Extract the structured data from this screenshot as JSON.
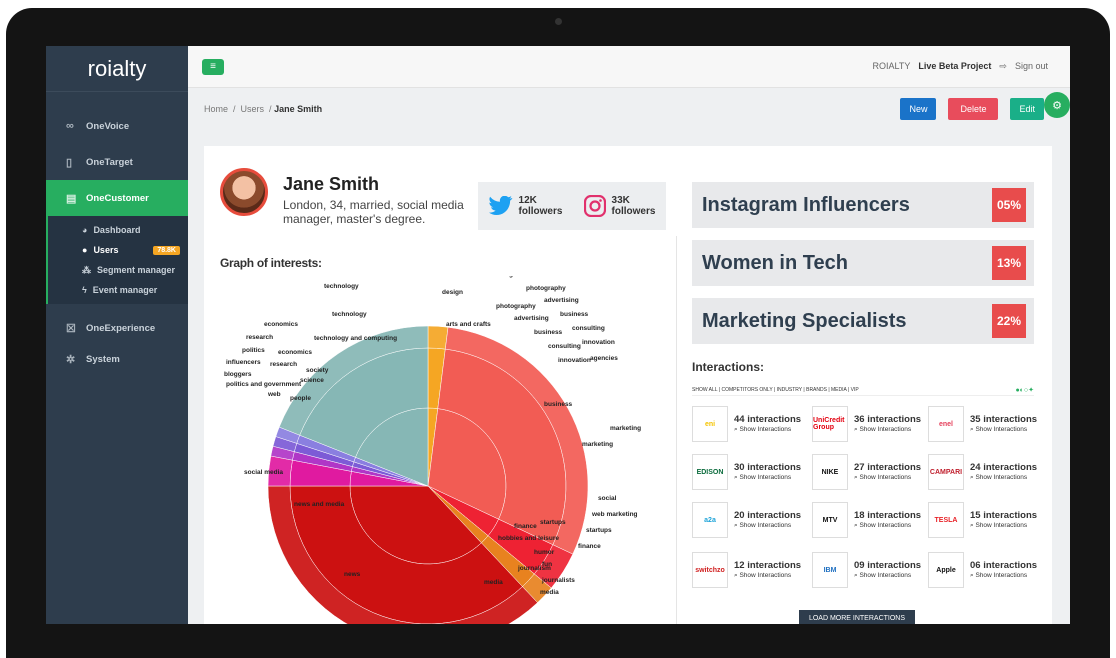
{
  "app": {
    "logo": "roialty"
  },
  "sidebar": {
    "items": [
      {
        "label": "OneVoice",
        "icon": "binoculars-icon"
      },
      {
        "label": "OneTarget",
        "icon": "phone-icon"
      },
      {
        "label": "OneCustomer",
        "icon": "card-icon"
      },
      {
        "label": "OneExperience",
        "icon": "experience-icon"
      },
      {
        "label": "System",
        "icon": "gear-icon"
      }
    ],
    "sub": [
      {
        "label": "Dashboard",
        "icon": "dashboard-icon"
      },
      {
        "label": "Users",
        "icon": "user-icon",
        "badge": "78.8K"
      },
      {
        "label": "Segment manager",
        "icon": "users-icon"
      },
      {
        "label": "Event manager",
        "icon": "bolt-icon"
      }
    ]
  },
  "topbar": {
    "brand": "ROIALTY",
    "project": "Live Beta Project",
    "signout": "Sign out"
  },
  "breadcrumb": {
    "home": "Home",
    "users": "Users",
    "current": "Jane Smith"
  },
  "actions": {
    "new": "New",
    "delete": "Delete",
    "edit": "Edit"
  },
  "profile": {
    "name": "Jane Smith",
    "description": "London, 34, married, social media manager, master's degree.",
    "twitter": {
      "count": "12K",
      "label": "followers"
    },
    "instagram": {
      "count": "33K",
      "label": "followers"
    }
  },
  "graph_title": "Graph of interests:",
  "segments": [
    {
      "name": "Instagram Influencers",
      "pct": "05%"
    },
    {
      "name": "Women in Tech",
      "pct": "13%"
    },
    {
      "name": "Marketing Specialists",
      "pct": "22%"
    }
  ],
  "interactions": {
    "title": "Interactions:",
    "filter": "SHOW ALL | COMPETITORS ONLY | INDUSTRY | BRANDS | MEDIA | VIP",
    "show_label": "Show Interactions",
    "load_more": "LOAD MORE INTERACTIONS",
    "brands": [
      {
        "logo": "eni",
        "count": "44 interactions",
        "color": "#f5c400"
      },
      {
        "logo": "UniCredit Group",
        "count": "36 interactions",
        "color": "#e3000f"
      },
      {
        "logo": "enel",
        "count": "35 interactions",
        "color": "#e53f5a"
      },
      {
        "logo": "EDISON",
        "count": "30 interactions",
        "color": "#0a6b3c"
      },
      {
        "logo": "NIKE",
        "count": "27 interactions",
        "color": "#111111"
      },
      {
        "logo": "CAMPARI",
        "count": "24 interactions",
        "color": "#c0202e"
      },
      {
        "logo": "a2a",
        "count": "20 interactions",
        "color": "#1da3d8"
      },
      {
        "logo": "MTV",
        "count": "18 interactions",
        "color": "#111111"
      },
      {
        "logo": "TESLA",
        "count": "15 interactions",
        "color": "#e82127"
      },
      {
        "logo": "switchzo",
        "count": "12 interactions",
        "color": "#d02020"
      },
      {
        "logo": "IBM",
        "count": "09 interactions",
        "color": "#1f70c1"
      },
      {
        "logo": "Apple",
        "count": "06 interactions",
        "color": "#111111"
      }
    ]
  },
  "chart_data": {
    "type": "sunburst",
    "inner": [
      {
        "name": "design",
        "value": 2,
        "color": "#f5a623"
      },
      {
        "name": "business",
        "value": 30,
        "color": "#f25c54"
      },
      {
        "name": "finance",
        "value": 4,
        "color": "#ee2233"
      },
      {
        "name": "journalism",
        "value": 2,
        "color": "#e8821f"
      },
      {
        "name": "news and media",
        "value": 37,
        "color": "#cc1111"
      },
      {
        "name": "politics and government",
        "value": 3,
        "color": "#e01aa0"
      },
      {
        "name": "society",
        "value": 1,
        "color": "#b036c7"
      },
      {
        "name": "research",
        "value": 1,
        "color": "#7c5bd6"
      },
      {
        "name": "economics",
        "value": 1,
        "color": "#8a7fe0"
      },
      {
        "name": "technology and computing",
        "value": 19,
        "color": "#86b7b5"
      }
    ],
    "labels": [
      "technology",
      "technology",
      "economics",
      "research",
      "politics",
      "influencers",
      "bloggers",
      "politics and government",
      "web",
      "people",
      "society",
      "science",
      "research",
      "economics",
      "technology and computing",
      "news",
      "design",
      "design",
      "photography",
      "photography",
      "advertising",
      "advertising",
      "business",
      "business",
      "consulting",
      "consulting",
      "innovation",
      "innovation",
      "agencies",
      "arts and crafts",
      "business",
      "marketing",
      "marketing",
      "social",
      "web marketing",
      "startups",
      "startups",
      "finance",
      "finance",
      "hobbies and leisure",
      "humor",
      "fun",
      "journalism",
      "journalists",
      "media",
      "media",
      "social media",
      "news and media"
    ]
  }
}
